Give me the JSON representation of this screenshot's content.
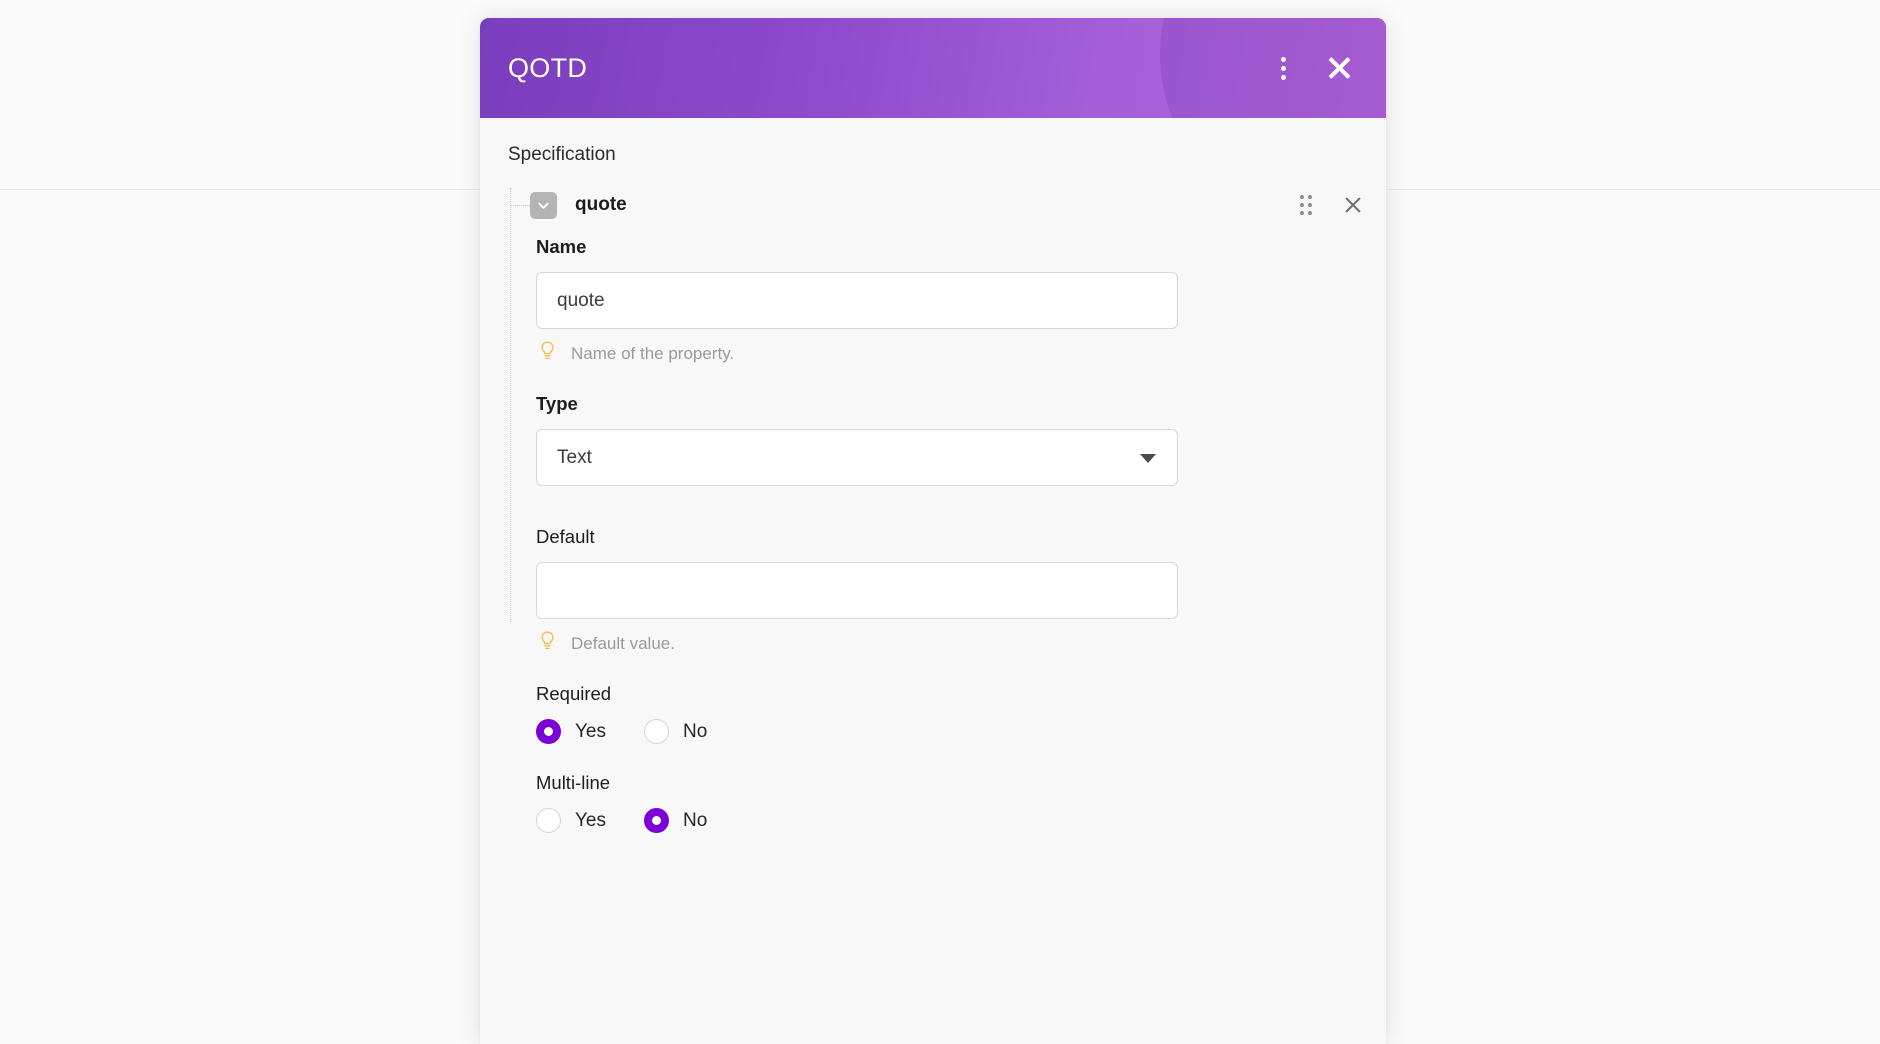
{
  "dialog": {
    "title": "QOTD",
    "menu_icon": "kebab-menu-icon",
    "close_icon": "close-icon",
    "section_label": "Specification"
  },
  "tree": {
    "node": {
      "label": "quote",
      "toggle_icon": "chevron-down-icon",
      "expanded": true,
      "drag_icon": "drag-handle-icon",
      "remove_icon": "close-icon"
    }
  },
  "form": {
    "name": {
      "label": "Name",
      "value": "quote",
      "placeholder": "",
      "hint": "Name of the property.",
      "hint_icon": "lightbulb-icon"
    },
    "type": {
      "label": "Type",
      "value": "Text",
      "caret_icon": "caret-down-icon",
      "options": [
        "Text"
      ]
    },
    "default": {
      "label": "Default",
      "value": "",
      "placeholder": "",
      "hint": "Default value.",
      "hint_icon": "lightbulb-icon"
    },
    "required": {
      "label": "Required",
      "options": [
        {
          "label": "Yes",
          "checked": true
        },
        {
          "label": "No",
          "checked": false
        }
      ]
    },
    "multiline": {
      "label": "Multi-line",
      "options": [
        {
          "label": "Yes",
          "checked": false
        },
        {
          "label": "No",
          "checked": true
        }
      ]
    }
  },
  "colors": {
    "header_gradient_start": "#7a3dbd",
    "header_gradient_end": "#b568dd",
    "radio_accent": "#7d00d4",
    "hint_bulb": "#f0c14b",
    "toggle_bg": "#b4b4b4"
  }
}
